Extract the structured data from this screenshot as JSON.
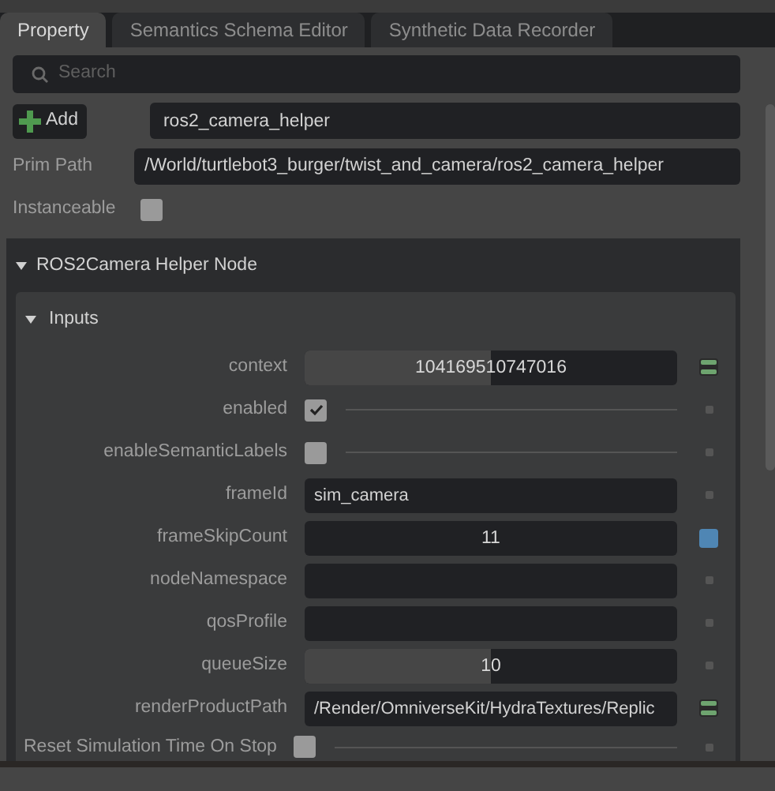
{
  "tabs": [
    {
      "label": "Property",
      "selected": true
    },
    {
      "label": "Semantics Schema Editor",
      "selected": false
    },
    {
      "label": "Synthetic Data Recorder",
      "selected": false
    }
  ],
  "search": {
    "placeholder": "Search"
  },
  "add_button": {
    "label": "Add"
  },
  "prim_name": {
    "value": "ros2_camera_helper"
  },
  "prim_path": {
    "label": "Prim Path",
    "value": "/World/turtlebot3_burger/twist_and_camera/ros2_camera_helper"
  },
  "instanceable": {
    "label": "Instanceable",
    "checked": false
  },
  "section": {
    "title": "ROS2Camera Helper Node",
    "expanded": true,
    "inputs": {
      "title": "Inputs",
      "expanded": true,
      "attributes": [
        {
          "name": "context",
          "kind": "number",
          "value": "104169510747016",
          "level": 0.5,
          "connected": true
        },
        {
          "name": "enabled",
          "kind": "checkbox",
          "checked": true,
          "connected": false,
          "modified": false
        },
        {
          "name": "enableSemanticLabels",
          "kind": "checkbox",
          "checked": false,
          "connected": false,
          "modified": false
        },
        {
          "name": "frameId",
          "kind": "text",
          "value": "sim_camera",
          "connected": false,
          "modified": false
        },
        {
          "name": "frameSkipCount",
          "kind": "number",
          "value": "11",
          "level": 0,
          "connected": false,
          "modified": true
        },
        {
          "name": "nodeNamespace",
          "kind": "text",
          "connected": false,
          "modified": false
        },
        {
          "name": "qosProfile",
          "kind": "text",
          "connected": false,
          "modified": false
        },
        {
          "name": "queueSize",
          "kind": "number",
          "value": "10",
          "level": 0.5,
          "connected": false,
          "modified": false
        },
        {
          "name": "renderProductPath",
          "kind": "text",
          "value": "/Render/OmniverseKit/HydraTextures/Replic",
          "connected": true
        }
      ]
    },
    "reset_row": {
      "label": "Reset Simulation Time On Stop",
      "checked": false,
      "connected": false,
      "modified": false
    }
  }
}
